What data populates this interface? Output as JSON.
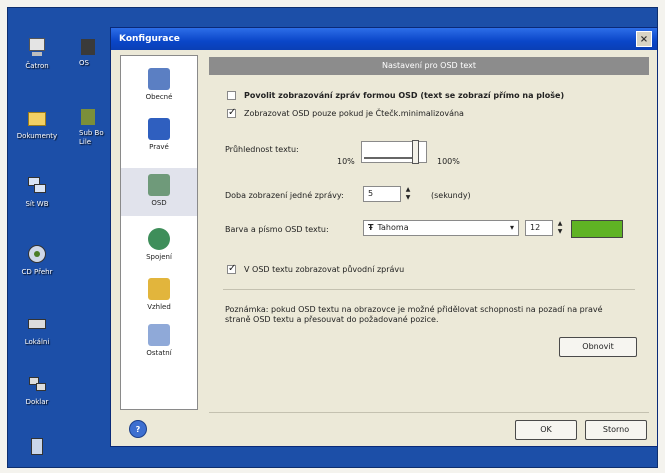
{
  "desktop": {
    "icons": [
      {
        "name": "computer",
        "label": "Čatron"
      },
      {
        "name": "documents",
        "label": "Dokumenty"
      },
      {
        "name": "network",
        "label": "Sít WB"
      },
      {
        "name": "cd-player",
        "label": "CD Přehr"
      },
      {
        "name": "drive",
        "label": "Lokálni"
      },
      {
        "name": "network-2",
        "label": "Doklar"
      },
      {
        "name": "recycle-bin",
        "label": ""
      }
    ],
    "partial_labels": [
      "OS",
      "Sub Bo Lile"
    ]
  },
  "window": {
    "title": "Konfigurace",
    "close_glyph": "×",
    "nav": [
      {
        "label": "Obecné",
        "icon": "general-icon",
        "active": false
      },
      {
        "label": "Pravé",
        "icon": "display-icon",
        "active": false
      },
      {
        "label": "OSD",
        "icon": "osd-icon",
        "active": true
      },
      {
        "label": "Spojení",
        "icon": "connection-icon",
        "active": false
      },
      {
        "label": "Vzhled",
        "icon": "appearance-icon",
        "active": false
      },
      {
        "label": "Ostatní",
        "icon": "other-icon",
        "active": false
      }
    ],
    "banner": "Nastavení pro OSD text",
    "option_main": "Povolit zobrazování zpráv formou OSD (text se zobrazí přímo na ploše)",
    "option_sub": "Zobrazovat OSD pouze pokud je Čtečk.minimalizována",
    "transparency_label": "Průhlednost textu:",
    "transparency_min": "10%",
    "transparency_max": "100%",
    "transparency_value": 0.85,
    "duration_label": "Doba zobrazení jedné zprávy:",
    "duration_value": "5",
    "duration_unit": "(sekundy)",
    "font_label": "Barva a písmo OSD textu:",
    "font_name": "Tahoma",
    "font_size": "12",
    "font_color": "#5fb324",
    "spin_up": "▲",
    "spin_down": "▼",
    "combo_arrow": "▾",
    "option_sender": "V OSD textu zobrazovat původní zprávu",
    "note": "Poznámka: pokud OSD textu na obrazovce je možné přidělovat schopnosti na pozadí na pravé straně OSD textu a přesouvat do požadované pozice.",
    "reset_button": "Obnovit",
    "ok_button": "OK",
    "cancel_button": "Storno",
    "help_glyph": "?"
  }
}
